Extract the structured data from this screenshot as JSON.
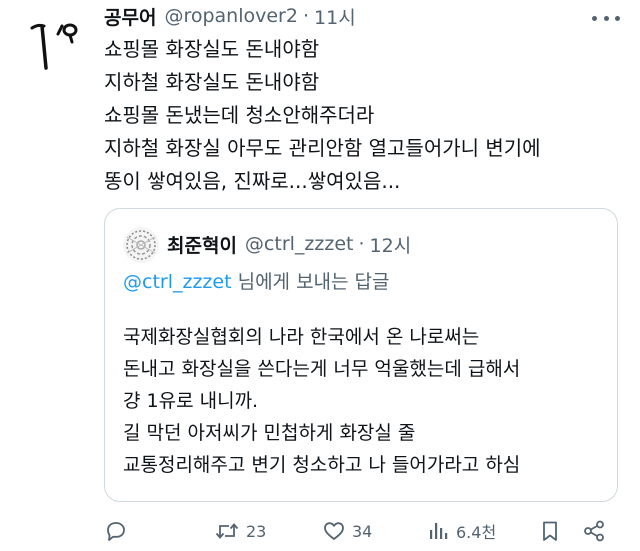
{
  "tweet": {
    "author_name": "공무어",
    "handle": "@ropanlover2",
    "separator": "·",
    "time": "11시",
    "lines": [
      "쇼핑몰 화장실도 돈내야함",
      "지하철 화장실도 돈내야함",
      "쇼핑몰 돈냈는데 청소안해주더라",
      "지하철 화장실 아무도 관리안함 열고들어가니 변기에",
      "똥이 쌓여있음, 진짜로...쌓여있음..."
    ]
  },
  "quote": {
    "author_name": "최준혁이",
    "handle": "@ctrl_zzzet",
    "separator": "·",
    "time": "12시",
    "reply_mention": "@ctrl_zzzet",
    "reply_suffix": " 님에게 보내는 답글",
    "lines": [
      "국제화장실협회의 나라 한국에서 온 나로써는",
      "돈내고 화장실을 쓴다는게 너무 억울했는데 급해서",
      "걍 1유로 내니까.",
      "길 막던 아저씨가 민첩하게 화장실 줄",
      "교통정리해주고 변기 청소하고 나 들어가라고 하심"
    ]
  },
  "actions": {
    "reply_icon": "reply-icon",
    "retweet_count": "23",
    "like_count": "34",
    "views_count": "6.4천",
    "bookmark_icon": "bookmark-icon",
    "share_icon": "share-icon"
  },
  "colors": {
    "text": "#0f1419",
    "secondary": "#536471",
    "link": "#1d9bf0",
    "border": "#cfd9de"
  }
}
